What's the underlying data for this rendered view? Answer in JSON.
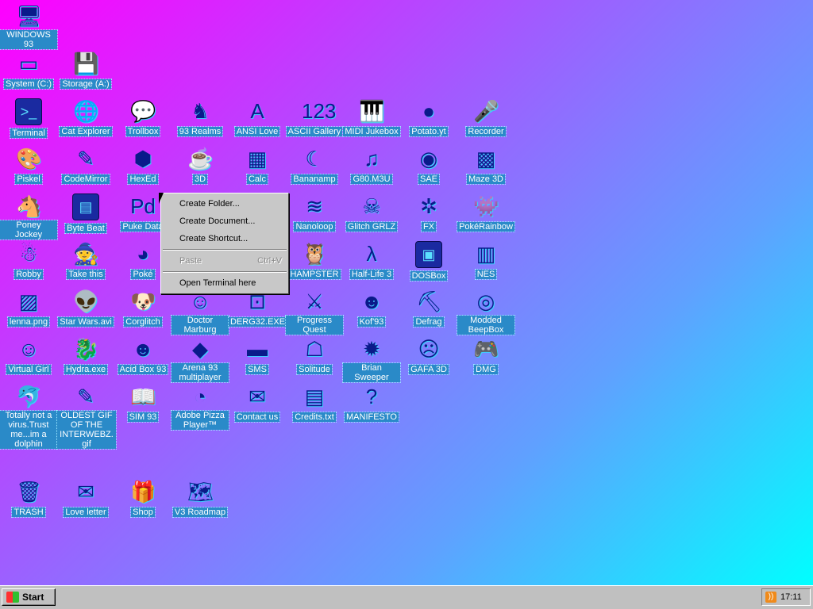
{
  "desktop": {
    "icons": [
      {
        "label": "WINDOWS 93",
        "icon": "computer-icon",
        "glyph": "🖥",
        "col": 0,
        "row": 0
      },
      {
        "label": "System (C:)",
        "icon": "drive-icon",
        "glyph": "▭",
        "col": 0,
        "row": 1
      },
      {
        "label": "Storage (A:)",
        "icon": "floppy-drive-icon",
        "glyph": "💾",
        "col": 1,
        "row": 1
      },
      {
        "label": "Terminal",
        "icon": "terminal-icon",
        "glyph": ">_",
        "col": 0,
        "row": 2,
        "box": true
      },
      {
        "label": "Cat Explorer",
        "icon": "globe-icon",
        "glyph": "🌐",
        "col": 1,
        "row": 2
      },
      {
        "label": "Trollbox",
        "icon": "chat-icon",
        "glyph": "💬",
        "col": 2,
        "row": 2
      },
      {
        "label": "93 Realms",
        "icon": "knight-icon",
        "glyph": "♞",
        "col": 3,
        "row": 2
      },
      {
        "label": "ANSI Love",
        "icon": "ansi-icon",
        "glyph": "A",
        "col": 4,
        "row": 2
      },
      {
        "label": "ASCII Gallery",
        "icon": "numbers-icon",
        "glyph": "123",
        "col": 5,
        "row": 2
      },
      {
        "label": "MIDI Jukebox",
        "icon": "piano-icon",
        "glyph": "🎹",
        "col": 6,
        "row": 2
      },
      {
        "label": "Potato.yt",
        "icon": "potato-icon",
        "glyph": "●",
        "col": 7,
        "row": 2
      },
      {
        "label": "Recorder",
        "icon": "microphone-icon",
        "glyph": "🎤",
        "col": 8,
        "row": 2
      },
      {
        "label": "Piskel",
        "icon": "palette-icon",
        "glyph": "🎨",
        "col": 0,
        "row": 3
      },
      {
        "label": "CodeMirror",
        "icon": "code-icon",
        "glyph": "✎",
        "col": 1,
        "row": 3
      },
      {
        "label": "HexEd",
        "icon": "hex-icon",
        "glyph": "⬢",
        "col": 2,
        "row": 3
      },
      {
        "label": "3D",
        "icon": "teapot-icon",
        "glyph": "☕",
        "col": 3,
        "row": 3
      },
      {
        "label": "Calc",
        "icon": "calculator-icon",
        "glyph": "▦",
        "col": 4,
        "row": 3
      },
      {
        "label": "Bananamp",
        "icon": "banana-icon",
        "glyph": "☾",
        "col": 5,
        "row": 3
      },
      {
        "label": "G80.M3U",
        "icon": "playlist-icon",
        "glyph": "♫",
        "col": 6,
        "row": 3
      },
      {
        "label": "SAE",
        "icon": "ball-icon",
        "glyph": "◉",
        "col": 7,
        "row": 3
      },
      {
        "label": "Maze 3D",
        "icon": "maze-icon",
        "glyph": "▩",
        "col": 8,
        "row": 3
      },
      {
        "label": "Poney Jockey",
        "icon": "pony-icon",
        "glyph": "🐴",
        "col": 0,
        "row": 4
      },
      {
        "label": "Byte Beat",
        "icon": "bytebeat-icon",
        "glyph": "▤",
        "col": 1,
        "row": 4,
        "box": true
      },
      {
        "label": "Puke Data",
        "icon": "pd-icon",
        "glyph": "Pd",
        "col": 2,
        "row": 4
      },
      {
        "label": "Nanoloop",
        "icon": "wave-icon",
        "glyph": "≋",
        "col": 5,
        "row": 4
      },
      {
        "label": "Glitch GRLZ",
        "icon": "glitch-icon",
        "glyph": "☠",
        "col": 6,
        "row": 4
      },
      {
        "label": "FX",
        "icon": "fx-icon",
        "glyph": "✲",
        "col": 7,
        "row": 4
      },
      {
        "label": "PokéRainbow",
        "icon": "pokemon-icon",
        "glyph": "👾",
        "col": 8,
        "row": 4
      },
      {
        "label": "Robby",
        "icon": "robot-icon",
        "glyph": "☃",
        "col": 0,
        "row": 5
      },
      {
        "label": "Take this",
        "icon": "mage-icon",
        "glyph": "🧙",
        "col": 1,
        "row": 5
      },
      {
        "label": "Poké",
        "icon": "poke-icon",
        "glyph": "◕",
        "col": 2,
        "row": 5
      },
      {
        "label": "HAMPSTER",
        "icon": "owl-icon",
        "glyph": "🦉",
        "col": 5,
        "row": 5
      },
      {
        "label": "Half-Life 3",
        "icon": "lambda-icon",
        "glyph": "λ",
        "col": 6,
        "row": 5
      },
      {
        "label": "DOSBox",
        "icon": "dosbox-icon",
        "glyph": "▣",
        "col": 7,
        "row": 5,
        "box": true
      },
      {
        "label": "NES",
        "icon": "nes-icon",
        "glyph": "▥",
        "col": 8,
        "row": 5
      },
      {
        "label": "lenna.png",
        "icon": "image-file-icon",
        "glyph": "▨",
        "col": 0,
        "row": 6
      },
      {
        "label": "Star Wars.avi",
        "icon": "yoda-icon",
        "glyph": "👽",
        "col": 1,
        "row": 6
      },
      {
        "label": "Corglitch",
        "icon": "corgi-icon",
        "glyph": "🐶",
        "col": 2,
        "row": 6
      },
      {
        "label": "Doctor Marburg",
        "icon": "doctor-icon",
        "glyph": "☺",
        "col": 3,
        "row": 6
      },
      {
        "label": "DERG32.EXE",
        "icon": "monitor-face-icon",
        "glyph": "⊡",
        "col": 4,
        "row": 6
      },
      {
        "label": "Progress Quest",
        "icon": "swords-icon",
        "glyph": "⚔",
        "col": 5,
        "row": 6
      },
      {
        "label": "Kof'93",
        "icon": "fighter-icon",
        "glyph": "☻",
        "col": 6,
        "row": 6
      },
      {
        "label": "Defrag",
        "icon": "defrag-icon",
        "glyph": "⛏",
        "col": 7,
        "row": 6
      },
      {
        "label": "Modded BeepBox",
        "icon": "disc-icon",
        "glyph": "◎",
        "col": 8,
        "row": 6
      },
      {
        "label": "Virtual Girl",
        "icon": "face-icon",
        "glyph": "☺",
        "col": 0,
        "row": 7
      },
      {
        "label": "Hydra.exe",
        "icon": "hydra-icon",
        "glyph": "🐉",
        "col": 1,
        "row": 7
      },
      {
        "label": "Acid Box 93",
        "icon": "smiley-icon",
        "glyph": "☻",
        "col": 2,
        "row": 7
      },
      {
        "label": "Arena 93 multiplayer",
        "icon": "cube-icon",
        "glyph": "◆",
        "col": 3,
        "row": 7
      },
      {
        "label": "SMS",
        "icon": "console-icon",
        "glyph": "▬",
        "col": 4,
        "row": 7
      },
      {
        "label": "Solitude",
        "icon": "lantern-icon",
        "glyph": "☖",
        "col": 5,
        "row": 7
      },
      {
        "label": "Brian Sweeper",
        "icon": "mine-icon",
        "glyph": "✹",
        "col": 6,
        "row": 7
      },
      {
        "label": "GAFA 3D",
        "icon": "person-icon",
        "glyph": "☹",
        "col": 7,
        "row": 7
      },
      {
        "label": "DMG",
        "icon": "gamepad-icon",
        "glyph": "🎮",
        "col": 8,
        "row": 7
      },
      {
        "label": "Totally not a virus.Trust me...im a dolphin",
        "icon": "dolphin-icon",
        "glyph": "🐬",
        "col": 0,
        "row": 8
      },
      {
        "label": "OLDEST GIF OF THE INTERWEBZ.gif",
        "icon": "gif-file-icon",
        "glyph": "✎",
        "col": 1,
        "row": 8
      },
      {
        "label": "SIM 93",
        "icon": "book-icon",
        "glyph": "📖",
        "col": 2,
        "row": 8
      },
      {
        "label": "Adobe Pizza Player™",
        "icon": "pizza-icon",
        "glyph": "◔",
        "col": 3,
        "row": 8
      },
      {
        "label": "Contact us",
        "icon": "contact-icon",
        "glyph": "✉",
        "col": 4,
        "row": 8
      },
      {
        "label": "Credits.txt",
        "icon": "text-file-icon",
        "glyph": "▤",
        "col": 5,
        "row": 8
      },
      {
        "label": "MANIFESTO",
        "icon": "question-icon",
        "glyph": "?",
        "col": 6,
        "row": 8
      },
      {
        "label": "TRASH",
        "icon": "trash-icon",
        "glyph": "🗑",
        "col": 0,
        "row": 10
      },
      {
        "label": "Love letter",
        "icon": "envelope-icon",
        "glyph": "✉",
        "col": 1,
        "row": 10
      },
      {
        "label": "Shop",
        "icon": "gift-icon",
        "glyph": "🎁",
        "col": 2,
        "row": 10
      },
      {
        "label": "V3 Roadmap",
        "icon": "map-icon",
        "glyph": "🗺",
        "col": 3,
        "row": 10
      }
    ]
  },
  "context_menu": {
    "items": [
      {
        "label": "Create Folder...",
        "shortcut": "",
        "disabled": false,
        "name": "menu-create-folder"
      },
      {
        "label": "Create Document...",
        "shortcut": "",
        "disabled": false,
        "name": "menu-create-document"
      },
      {
        "label": "Create Shortcut...",
        "shortcut": "",
        "disabled": false,
        "name": "menu-create-shortcut"
      },
      {
        "separator": true
      },
      {
        "label": "Paste",
        "shortcut": "Ctrl+V",
        "disabled": true,
        "name": "menu-paste"
      },
      {
        "separator": true
      },
      {
        "label": "Open Terminal here",
        "shortcut": "",
        "disabled": false,
        "name": "menu-open-terminal"
      }
    ]
  },
  "taskbar": {
    "start_label": "Start",
    "clock": "17:11",
    "tray_icon": "rss-icon"
  }
}
